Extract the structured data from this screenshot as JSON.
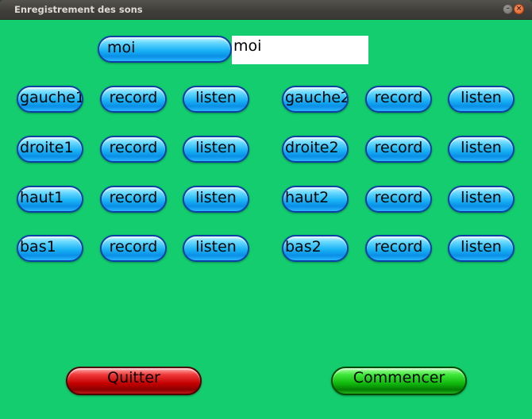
{
  "window": {
    "title": "Enregistrement des sons",
    "minimize_glyph": "–",
    "close_glyph": "×"
  },
  "name_row": {
    "button_label": "moi",
    "field_value": "moi"
  },
  "left_rows": [
    {
      "name": "gauche1",
      "record": "record",
      "listen": "listen"
    },
    {
      "name": "droite1",
      "record": "record",
      "listen": "listen"
    },
    {
      "name": "haut1",
      "record": "record",
      "listen": "listen"
    },
    {
      "name": "bas1",
      "record": "record",
      "listen": "listen"
    }
  ],
  "right_rows": [
    {
      "name": "gauche2",
      "record": "record",
      "listen": "listen"
    },
    {
      "name": "droite2",
      "record": "record",
      "listen": "listen"
    },
    {
      "name": "haut2",
      "record": "record",
      "listen": "listen"
    },
    {
      "name": "bas2",
      "record": "record",
      "listen": "listen"
    }
  ],
  "footer": {
    "quit_label": "Quitter",
    "start_label": "Commencer"
  },
  "colors": {
    "background": "#13cd6e",
    "pill": "#19b3f5",
    "quit": "#c40000",
    "start": "#10b80d"
  }
}
